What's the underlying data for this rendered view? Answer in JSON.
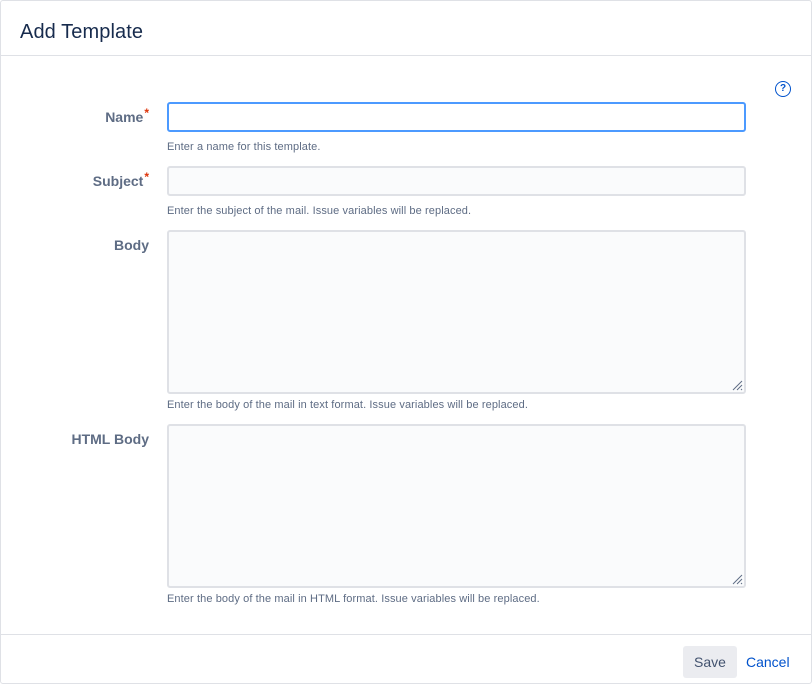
{
  "dialog": {
    "title": "Add Template",
    "help_icon": "question-circle-icon",
    "help_glyph": "?"
  },
  "form": {
    "name": {
      "label": "Name",
      "required_mark": "*",
      "value": "",
      "description": "Enter a name for this template."
    },
    "subject": {
      "label": "Subject",
      "required_mark": "*",
      "value": "",
      "description": "Enter the subject of the mail. Issue variables will be replaced."
    },
    "body": {
      "label": "Body",
      "value": "",
      "description": "Enter the body of the mail in text format. Issue variables will be replaced."
    },
    "html_body": {
      "label": "HTML Body",
      "value": "",
      "description": "Enter the body of the mail in HTML format. Issue variables will be replaced."
    }
  },
  "footer": {
    "save_label": "Save",
    "cancel_label": "Cancel"
  },
  "colors": {
    "accent": "#0052cc",
    "focus_border": "#4c9aff",
    "required": "#de350b",
    "label": "#5e6c84",
    "title": "#172b4d"
  }
}
